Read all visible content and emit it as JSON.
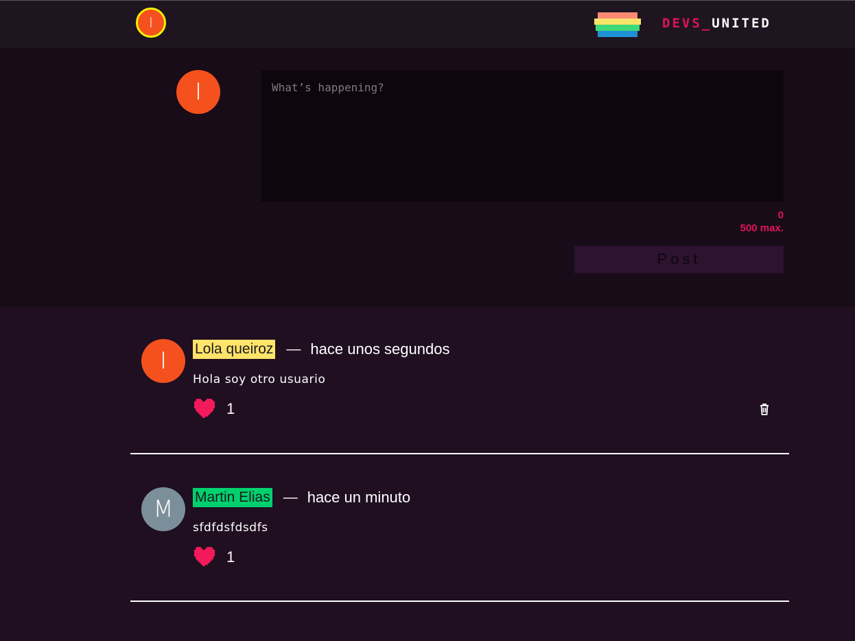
{
  "header": {
    "avatar_initial": "I",
    "brand_left": "DEVS_",
    "brand_right": "UNITED",
    "logo_colors": [
      "#ff8a73",
      "#f7e36a",
      "#3dd97a",
      "#1e90d6"
    ]
  },
  "composer": {
    "avatar_initial": "I",
    "placeholder": "What’s happening?",
    "char_count": "0",
    "char_max": "500 max.",
    "post_label": "Post"
  },
  "posts": [
    {
      "avatar_initial": "I",
      "avatar_color": "#f5511e",
      "username": "Lola queiroz",
      "username_color": "#ffe46a",
      "dash": "—",
      "time": "hace unos segundos",
      "text": "Hola soy otro usuario",
      "likes": "1",
      "deletable": true
    },
    {
      "avatar_initial": "M",
      "avatar_color": "#7b8f9a",
      "username": "Martin Elias",
      "username_color": "#00d16f",
      "dash": "—",
      "time": "hace un minuto",
      "text": "sfdfdsfdsdfs",
      "likes": "1",
      "deletable": false
    }
  ],
  "colors": {
    "accent": "#e0115e",
    "heart": "#f21a5a"
  }
}
